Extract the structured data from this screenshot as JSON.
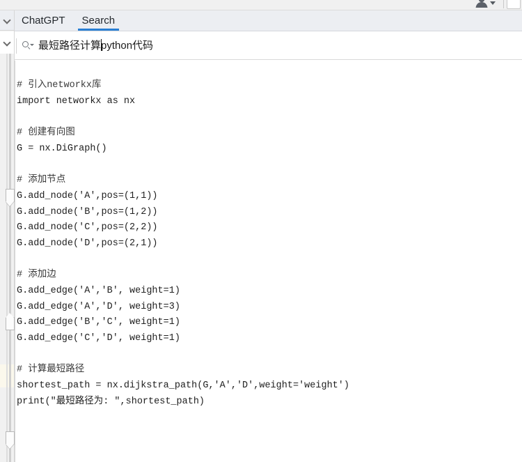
{
  "window": {
    "avatar_icon": "user-avatar-icon",
    "avatar_caret_icon": "caret-down-icon"
  },
  "gutter": {
    "chevron_top_icon": "chevron-down-icon",
    "chevron_second_icon": "chevron-down-icon"
  },
  "tabs": [
    {
      "label": "ChatGPT",
      "active": false
    },
    {
      "label": "Search",
      "active": true
    }
  ],
  "search": {
    "icon": "search-icon",
    "dropdown_icon": "caret-down-icon",
    "value_before_caret": "最短路径计算",
    "value_after_caret": "python代码",
    "full_value": "最短路径计算python代码"
  },
  "code": {
    "language": "python",
    "lines": [
      "# 引入networkx库",
      "import networkx as nx",
      "",
      "# 创建有向图",
      "G = nx.DiGraph()",
      "",
      "# 添加节点",
      "G.add_node('A',pos=(1,1))",
      "G.add_node('B',pos=(1,2))",
      "G.add_node('C',pos=(2,2))",
      "G.add_node('D',pos=(2,1))",
      "",
      "# 添加边",
      "G.add_edge('A','B', weight=1)",
      "G.add_edge('A','D', weight=3)",
      "G.add_edge('B','C', weight=1)",
      "G.add_edge('C','D', weight=1)",
      "",
      "# 计算最短路径",
      "shortest_path = nx.dijkstra_path(G,'A','D',weight='weight')",
      "print(\"最短路径为: \",shortest_path)"
    ]
  },
  "colors": {
    "accent": "#2a7fd4",
    "toolbar_bg": "#f0f0f0",
    "tabbar_bg": "#eceef2",
    "gutter_bg": "#f1f1f1",
    "highlight_bg": "#fbf8ec",
    "text": "#202020"
  }
}
